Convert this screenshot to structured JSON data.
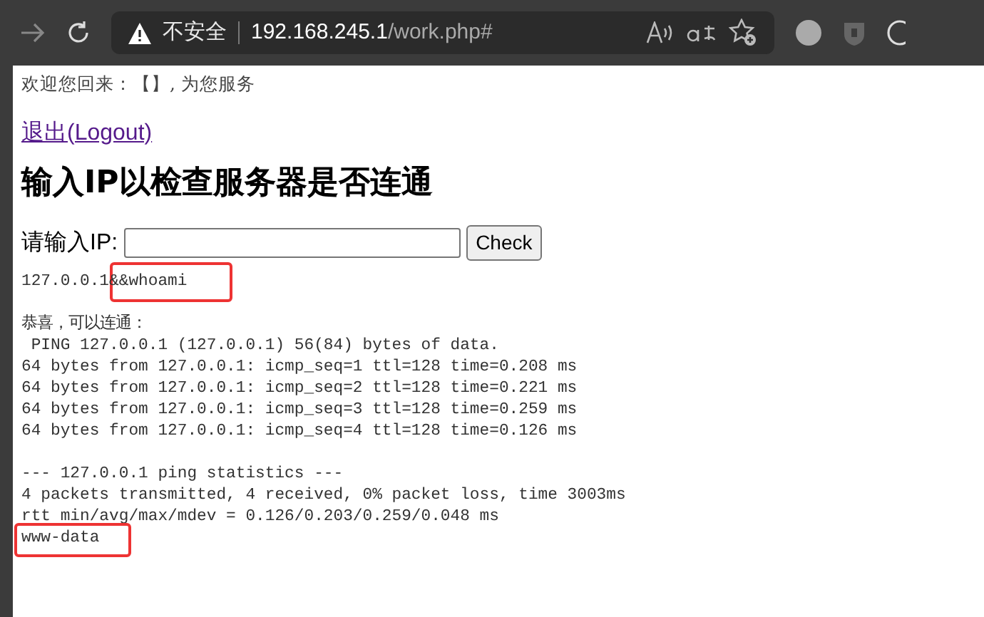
{
  "browser": {
    "security_label": "不安全",
    "url_host": "192.168.245.1",
    "url_path": "/work.php#"
  },
  "page": {
    "welcome": "欢迎您回来：【】, 为您服务",
    "logout_link": "退出(Logout)",
    "heading": "输入IP以检查服务器是否连通",
    "ip_label": "请输入IP:",
    "check_button": "Check",
    "output_blocks": [
      {
        "lines": [
          {
            "text": "127.0.0.1&&whoami",
            "highlighted": true
          }
        ]
      },
      {
        "lines": [
          {
            "text": "恭喜，可以连通：",
            "highlighted": false
          },
          {
            "text": " PING 127.0.0.1 (127.0.0.1) 56(84) bytes of data.",
            "highlighted": false
          },
          {
            "text": "64 bytes from 127.0.0.1: icmp_seq=1 ttl=128 time=0.208 ms",
            "highlighted": false
          },
          {
            "text": "64 bytes from 127.0.0.1: icmp_seq=2 ttl=128 time=0.221 ms",
            "highlighted": false
          },
          {
            "text": "64 bytes from 127.0.0.1: icmp_seq=3 ttl=128 time=0.259 ms",
            "highlighted": false
          },
          {
            "text": "64 bytes from 127.0.0.1: icmp_seq=4 ttl=128 time=0.126 ms",
            "highlighted": false
          }
        ]
      },
      {
        "lines": [
          {
            "text": "--- 127.0.0.1 ping statistics ---",
            "highlighted": false
          },
          {
            "text": "4 packets transmitted, 4 received, 0% packet loss, time 3003ms",
            "highlighted": false
          },
          {
            "text": "rtt min/avg/max/mdev = 0.126/0.203/0.259/0.048 ms",
            "highlighted": false
          },
          {
            "text": "www-data",
            "highlighted": true
          }
        ]
      }
    ]
  }
}
